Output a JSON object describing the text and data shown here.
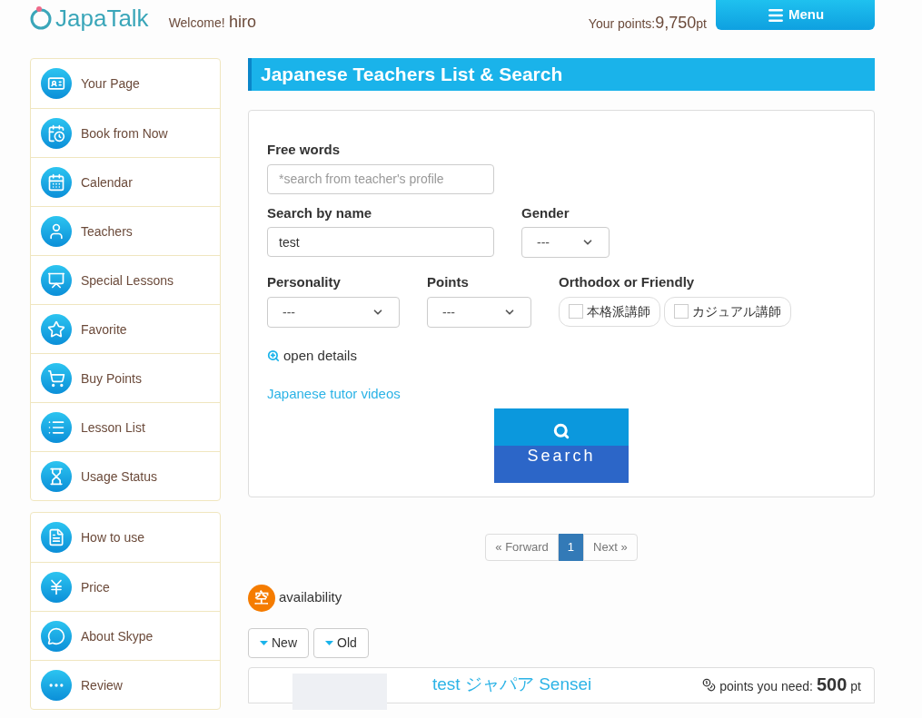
{
  "header": {
    "logo": "JapaTalk",
    "welcome_label": "Welcome!",
    "user_name": "hiro",
    "points_label": "Your points:",
    "points_value": "9,750",
    "points_unit": "pt",
    "menu_button": "Menu"
  },
  "sidebar": {
    "groups": [
      {
        "items": [
          {
            "label": "Your Page"
          },
          {
            "label": "Book from Now"
          },
          {
            "label": "Calendar"
          },
          {
            "label": "Teachers"
          },
          {
            "label": "Special Lessons"
          },
          {
            "label": "Favorite"
          },
          {
            "label": "Buy Points"
          },
          {
            "label": "Lesson List"
          },
          {
            "label": "Usage Status"
          }
        ]
      },
      {
        "items": [
          {
            "label": "How to use"
          },
          {
            "label": "Price"
          },
          {
            "label": "About Skype"
          },
          {
            "label": "Review"
          }
        ]
      }
    ]
  },
  "main": {
    "title": "Japanese Teachers List & Search",
    "search_form": {
      "free_words": {
        "label": "Free words",
        "placeholder": "*search from teacher's profile"
      },
      "name": {
        "label": "Search by name",
        "value": "test"
      },
      "gender": {
        "label": "Gender",
        "value": "---"
      },
      "personality": {
        "label": "Personality",
        "value": "---"
      },
      "points": {
        "label": "Points",
        "value": "---"
      },
      "style": {
        "label": "Orthodox or Friendly",
        "options": [
          {
            "label": "本格派講師",
            "checked": false
          },
          {
            "label": "カジュアル講師",
            "checked": false
          }
        ]
      },
      "open_details": "open details",
      "videos_link": "Japanese tutor videos",
      "search_button": "Search"
    },
    "pagination": {
      "previous": "« Forward",
      "pages": [
        {
          "label": "1",
          "selected": true
        }
      ],
      "next": "Next »"
    },
    "legend": {
      "badge": "空",
      "label": "availability"
    },
    "sort_buttons": [
      {
        "label": "New"
      },
      {
        "label": "Old"
      }
    ],
    "teacher_card": {
      "name": "test ジャパア Sensei",
      "points_label": "points you need:",
      "points_value": "500",
      "points_unit": "pt"
    }
  }
}
